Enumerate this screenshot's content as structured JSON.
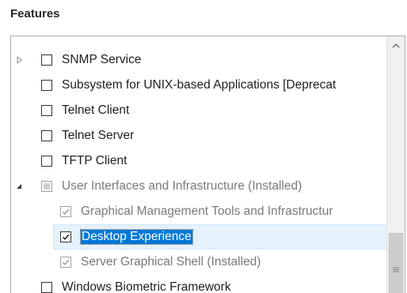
{
  "title": "Features",
  "icons": {
    "expand": "collapsed-triangle-icon",
    "collapse": "expanded-triangle-icon",
    "check": "checkmark-icon",
    "scroll_up": "chevron-up-icon",
    "grip": "scrollbar-grip-icon"
  },
  "colors": {
    "selection": "#0078d7",
    "hover_row": "#e5f1fb",
    "disabled_text": "#7a7a7a"
  },
  "features": [
    {
      "label": "SNMP Service",
      "state": "unchecked",
      "expander": "collapsed",
      "level": 0
    },
    {
      "label": "Subsystem for UNIX-based Applications [Deprecat",
      "state": "unchecked",
      "expander": "none",
      "level": 0
    },
    {
      "label": "Telnet Client",
      "state": "unchecked",
      "expander": "none",
      "level": 0
    },
    {
      "label": "Telnet Server",
      "state": "unchecked",
      "expander": "none",
      "level": 0
    },
    {
      "label": "TFTP Client",
      "state": "unchecked",
      "expander": "none",
      "level": 0
    },
    {
      "label": "User Interfaces and Infrastructure (Installed)",
      "state": "indeterminate-disabled",
      "expander": "expanded",
      "level": 0
    },
    {
      "label": "Graphical Management Tools and Infrastructur",
      "state": "checked-disabled",
      "expander": "none",
      "level": 1
    },
    {
      "label": "Desktop Experience",
      "state": "checked",
      "expander": "none",
      "level": 1,
      "selected": true
    },
    {
      "label": "Server Graphical Shell (Installed)",
      "state": "checked-disabled",
      "expander": "none",
      "level": 1
    },
    {
      "label": "Windows Biometric Framework",
      "state": "unchecked",
      "expander": "none",
      "level": 0
    }
  ]
}
